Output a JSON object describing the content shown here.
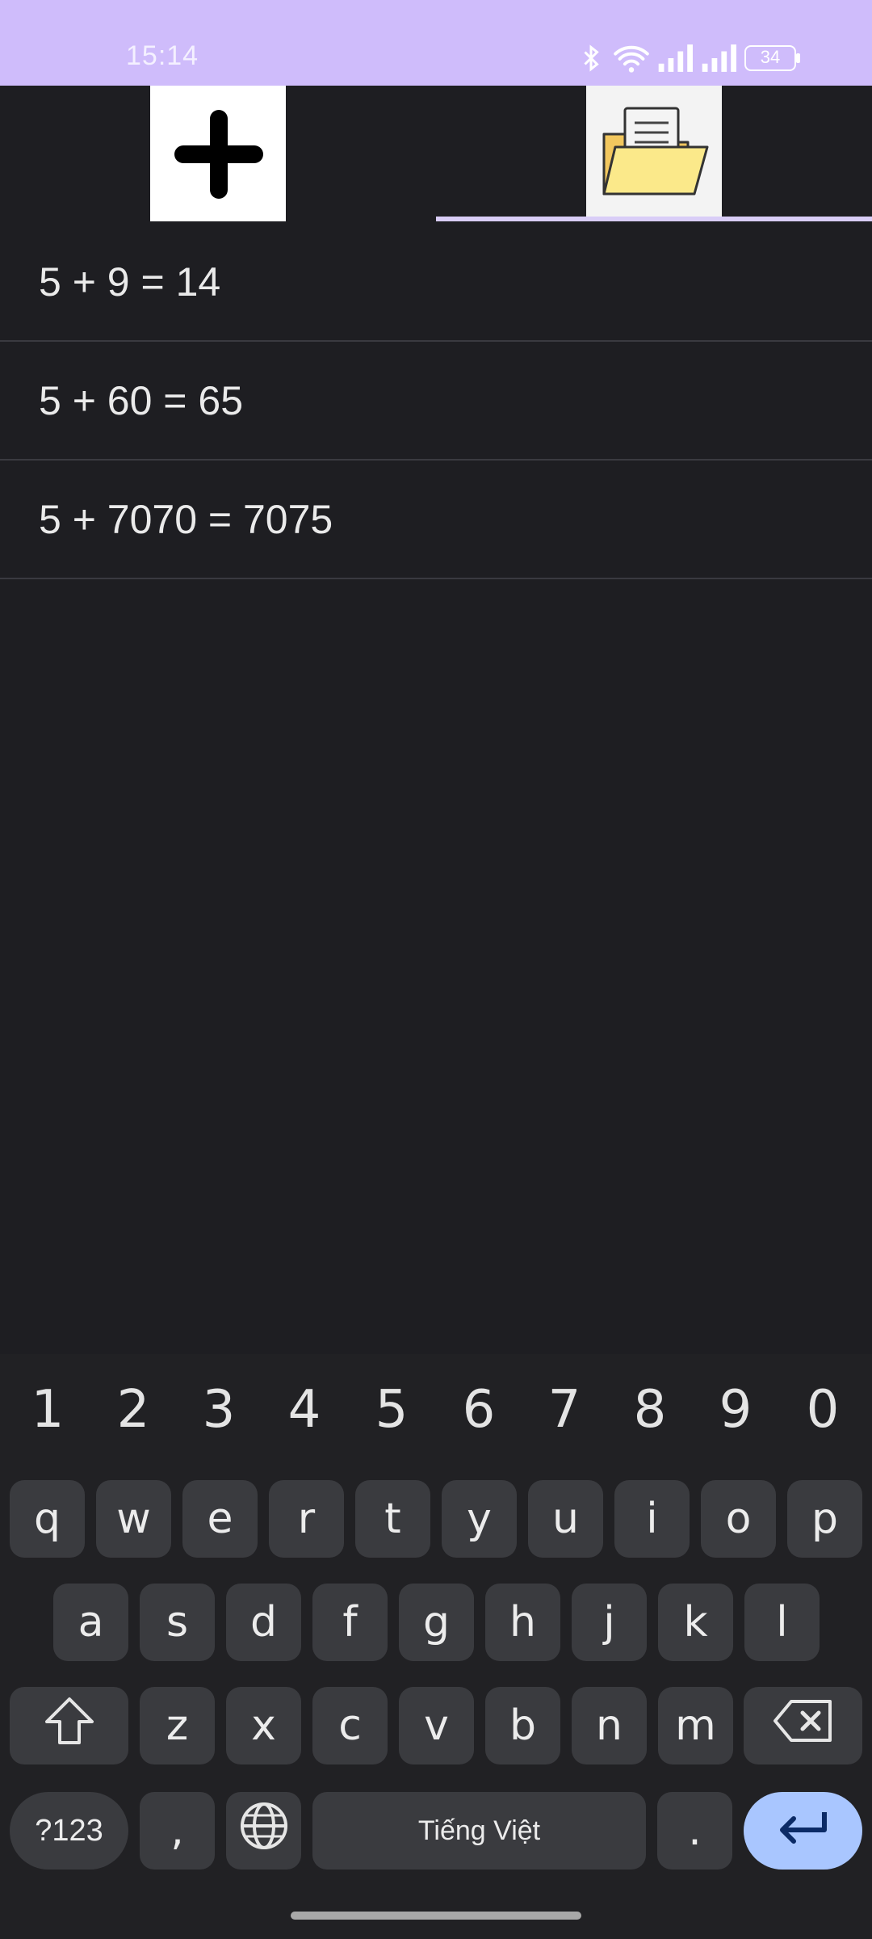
{
  "status_bar": {
    "time": "15:14",
    "battery": "34",
    "icons": [
      "bluetooth-icon",
      "wifi-icon",
      "signal-icon",
      "signal-icon",
      "battery-icon"
    ]
  },
  "tabs": [
    {
      "name": "add",
      "icon": "plus-icon"
    },
    {
      "name": "history",
      "icon": "folder-document-icon",
      "selected": true
    }
  ],
  "history": [
    "5 + 9 = 14",
    "5 + 60 = 65",
    "5 + 7070 = 7075"
  ],
  "keyboard": {
    "numbers": [
      "1",
      "2",
      "3",
      "4",
      "5",
      "6",
      "7",
      "8",
      "9",
      "0"
    ],
    "row1": [
      "q",
      "w",
      "e",
      "r",
      "t",
      "y",
      "u",
      "i",
      "o",
      "p"
    ],
    "row2": [
      "a",
      "s",
      "d",
      "f",
      "g",
      "h",
      "j",
      "k",
      "l"
    ],
    "row3": [
      "z",
      "x",
      "c",
      "v",
      "b",
      "n",
      "m"
    ],
    "symbols_label": "?123",
    "comma": ",",
    "space_label": "Tiếng Việt",
    "period": ".",
    "colors": {
      "accent": "#a9c6ff",
      "key": "#3a3b3f",
      "background": "#212124"
    }
  },
  "colors": {
    "status_bar": "#cfbcfb",
    "background": "#1e1e22",
    "tab_indicator": "#d9cdf7"
  }
}
